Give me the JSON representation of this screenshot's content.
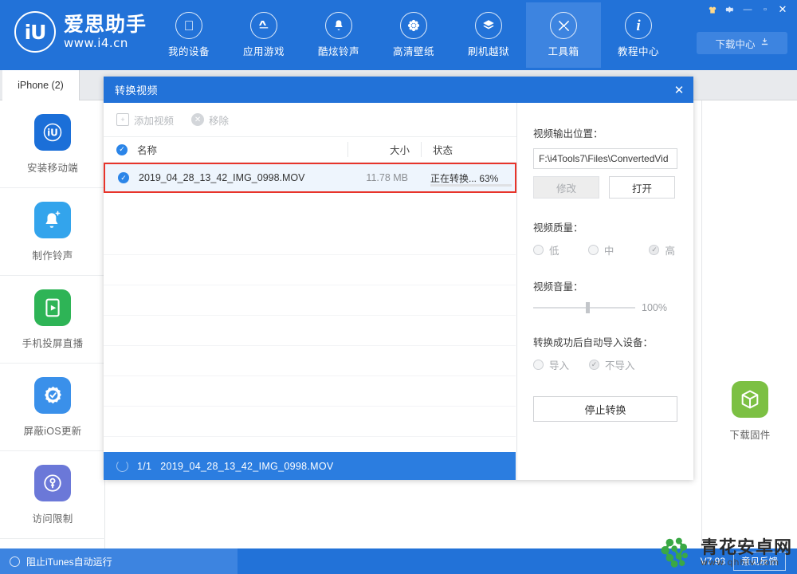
{
  "header": {
    "logo": {
      "mark": "iU",
      "name_cn": "爱思助手",
      "url": "www.i4.cn"
    },
    "nav": [
      {
        "label": "我的设备",
        "icon": "apple-icon",
        "active": false
      },
      {
        "label": "应用游戏",
        "icon": "appstore-icon",
        "active": false
      },
      {
        "label": "酷炫铃声",
        "icon": "bell-icon",
        "active": false
      },
      {
        "label": "高清壁纸",
        "icon": "flower-icon",
        "active": false
      },
      {
        "label": "刷机越狱",
        "icon": "flash-box-icon",
        "active": false
      },
      {
        "label": "工具箱",
        "icon": "tools-icon",
        "active": true
      },
      {
        "label": "教程中心",
        "icon": "info-icon",
        "active": false
      }
    ],
    "window_controls": {
      "shirt": "shirt-icon",
      "gear": "gear-icon",
      "minimize": "—",
      "maximize": "▫",
      "close": "✕"
    },
    "download_center": {
      "label": "下载中心",
      "icon": "download-icon"
    }
  },
  "tabs": [
    {
      "label": "iPhone (2)",
      "active": true
    }
  ],
  "sidebar": {
    "items": [
      {
        "label": "安装移动端",
        "icon": "i4-app-icon",
        "color": "#1b6fd8"
      },
      {
        "label": "制作铃声",
        "icon": "bell-plus-icon",
        "color": "#33a4ec"
      },
      {
        "label": "手机投屏直播",
        "icon": "screen-cast-icon",
        "color": "#2eb456"
      },
      {
        "label": "屏蔽iOS更新",
        "icon": "block-update-icon",
        "color": "#3a90ea"
      },
      {
        "label": "访问限制",
        "icon": "key-lock-icon",
        "color": "#6b78d8"
      }
    ]
  },
  "rightbar": {
    "items": [
      {
        "label": "下载固件",
        "icon": "firmware-box-icon",
        "color": "#7cc043"
      }
    ]
  },
  "dialog": {
    "title": "转换视频",
    "close_label": "✕",
    "toolbar": {
      "add_video": "添加视频",
      "add_video_icon": "add-file-icon",
      "remove": "移除",
      "remove_icon": "remove-circle-icon"
    },
    "columns": {
      "name": "名称",
      "size": "大小",
      "state": "状态"
    },
    "files": [
      {
        "name": "2019_04_28_13_42_IMG_0998.MOV",
        "size": "11.78 MB",
        "state": "正在转换... 63%",
        "progress": 63,
        "checked": true,
        "highlighted": true
      }
    ],
    "status_bar": {
      "counter": "1/1",
      "filename": "2019_04_28_13_42_IMG_0998.MOV",
      "spinner": "loading-spinner-icon"
    },
    "settings": {
      "output_label": "视频输出位置：",
      "output_path": "F:\\i4Tools7\\Files\\ConvertedVid",
      "modify_button": "修改",
      "open_button": "打开",
      "quality_label": "视频质量：",
      "quality_options": [
        {
          "label": "低",
          "selected": false
        },
        {
          "label": "中",
          "selected": false
        },
        {
          "label": "高",
          "selected": true
        }
      ],
      "volume_label": "视频音量：",
      "volume_value": "100%",
      "volume_percent": 100,
      "auto_import_label": "转换成功后自动导入设备：",
      "auto_import_options": [
        {
          "label": "导入",
          "selected": false
        },
        {
          "label": "不导入",
          "selected": true
        }
      ],
      "action_button": "停止转换"
    }
  },
  "bottom_bar": {
    "itunes_toggle": "阻止iTunes自动运行",
    "version": "V7.93",
    "feedback": "意见反馈"
  },
  "watermark": {
    "name_cn": "青花安卓网",
    "url": "www.qhhlv.com"
  },
  "colors": {
    "brand_blue": "#2272d8",
    "nav_active": "#3d84e0",
    "accent_blue": "#2b85e8",
    "highlight_red": "#e8342a",
    "progress_blue": "#3b90e8"
  }
}
